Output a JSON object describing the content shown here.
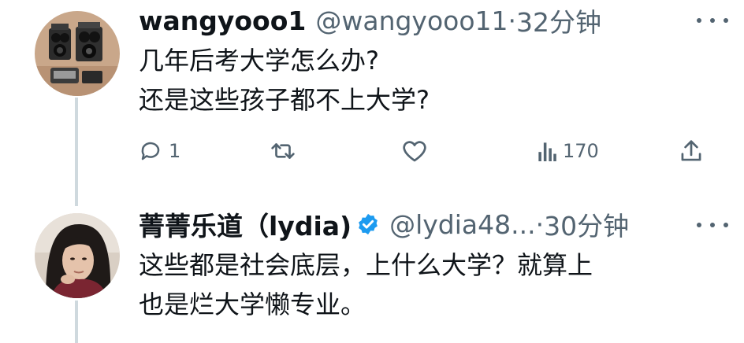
{
  "tweets": [
    {
      "author": "wangyooo1",
      "handle": "@wangyooo11",
      "separator": "·",
      "time": "32分钟",
      "lines": [
        "几年后考大学怎么办?",
        "还是这些孩子都不上大学?"
      ],
      "replies": "1",
      "views": "170",
      "avatar_icon": "cameras-photo"
    },
    {
      "author": "菁菁乐道（lydia)",
      "handle": "@lydia48...",
      "separator": "·",
      "time": "30分钟",
      "verified": true,
      "lines": [
        "这些都是社会底层，上什么大学？就算上",
        "也是烂大学懒专业。"
      ],
      "avatar_icon": "woman-portrait"
    }
  ],
  "icons": {
    "reply": "reply-icon",
    "retweet": "retweet-icon",
    "like": "heart-icon",
    "views": "views-icon",
    "share": "share-icon",
    "verified": "verified-badge-icon",
    "more": "more-icon"
  },
  "colors": {
    "text": "#0f1419",
    "secondary": "#536471",
    "verified": "#1d9bf0",
    "thread_line": "#cfd9de"
  }
}
